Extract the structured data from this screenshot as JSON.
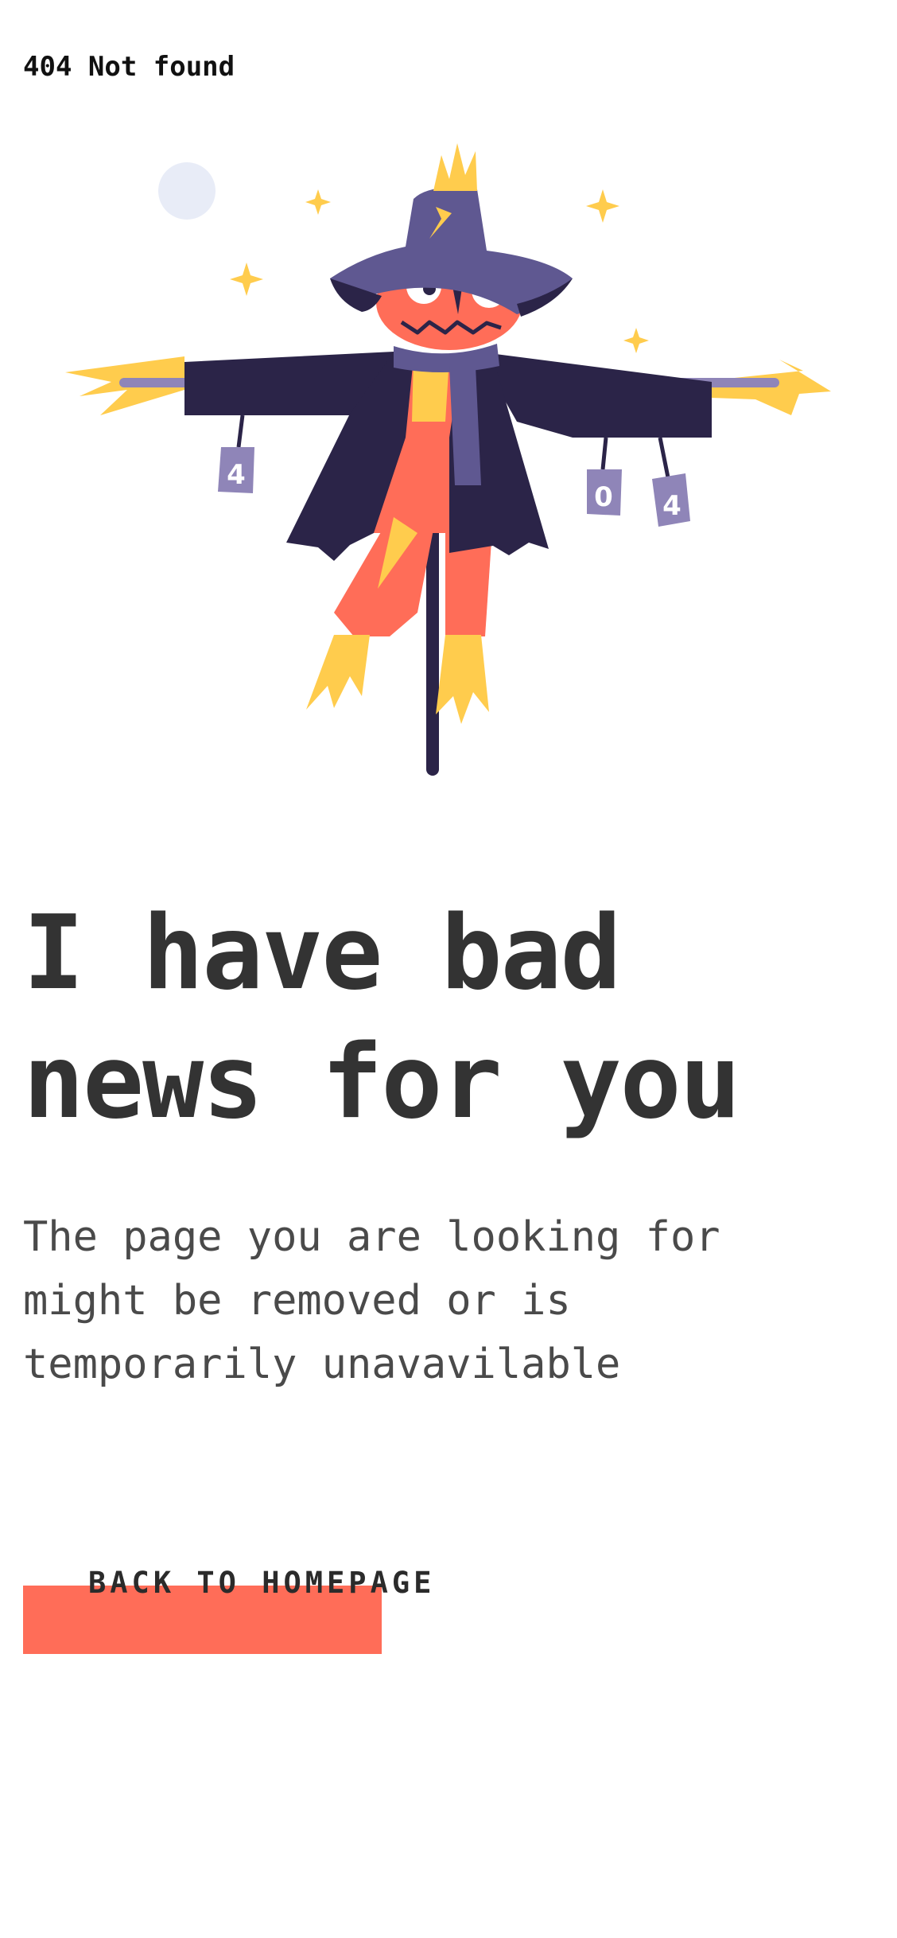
{
  "header": {
    "status_text": "404 Not found"
  },
  "illustration": {
    "subject": "scarecrow",
    "can_labels": [
      "4",
      "0",
      "4"
    ],
    "colors": {
      "moon": "#e8ecf7",
      "sparkle": "#ffcc4d",
      "hat": "#5f5891",
      "hat_dark": "#2b2448",
      "face": "#ff6d58",
      "coat": "#2b2448",
      "scarf": "#5f5891",
      "straw": "#ffcc4d",
      "can": "#8f85b8",
      "pole": "#2b2448"
    }
  },
  "main": {
    "headline_lines": [
      "I have bad",
      "news for you"
    ],
    "body_lines": [
      "The page you are looking for",
      "might be removed or is",
      "temporarily unavavilable"
    ]
  },
  "cta": {
    "label": "BACK TO HOMEPAGE",
    "accent": "#ff6d58"
  }
}
